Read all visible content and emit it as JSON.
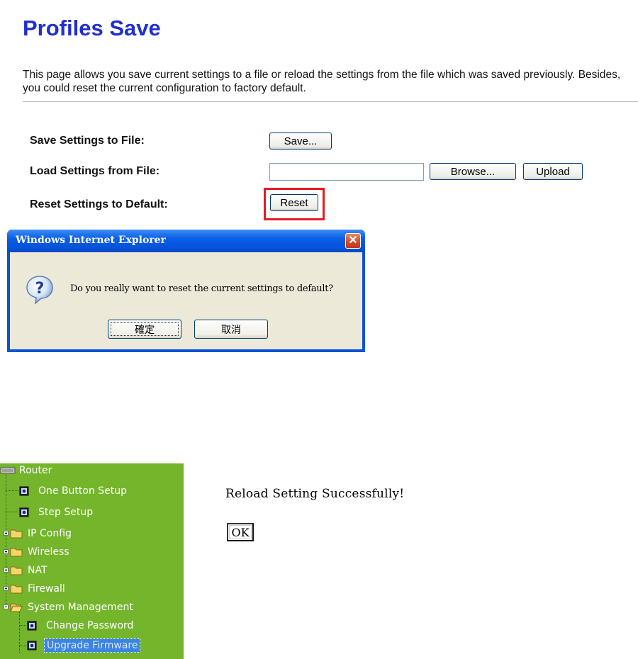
{
  "profiles": {
    "title": "Profiles Save",
    "description": "This page allows you save current settings to a file or reload the settings from the file which was saved previously. Besides, you could reset the current configuration to factory default.",
    "save_label": "Save Settings to File:",
    "save_button": "Save...",
    "load_label": "Load Settings from File:",
    "file_value": "",
    "browse_button": "Browse...",
    "upload_button": "Upload",
    "reset_label": "Reset Settings to Default:",
    "reset_button": "Reset",
    "highlight_color": "#e41b23"
  },
  "dialog": {
    "title": "Windows Internet Explorer",
    "close_icon": "close-icon",
    "message": "Do you really want to reset the current settings to default?",
    "ok_label": "確定",
    "cancel_label": "取消",
    "icon": "question-icon"
  },
  "sidebar": {
    "root": "Router",
    "items": [
      {
        "label": "One Button Setup",
        "icon": "page-icon"
      },
      {
        "label": "Step Setup",
        "icon": "page-icon"
      },
      {
        "label": "IP Config",
        "icon": "folder-icon"
      },
      {
        "label": "Wireless",
        "icon": "folder-icon"
      },
      {
        "label": "NAT",
        "icon": "folder-icon"
      },
      {
        "label": "Firewall",
        "icon": "folder-icon"
      },
      {
        "label": "System Management",
        "icon": "folder-open-icon"
      },
      {
        "label": "Change Password",
        "icon": "page-icon"
      },
      {
        "label": "Upgrade Firmware",
        "icon": "page-icon",
        "selected": true
      }
    ],
    "background": "#74b52c"
  },
  "reload": {
    "message": "Reload Setting Successfully!",
    "ok_label": "OK"
  }
}
